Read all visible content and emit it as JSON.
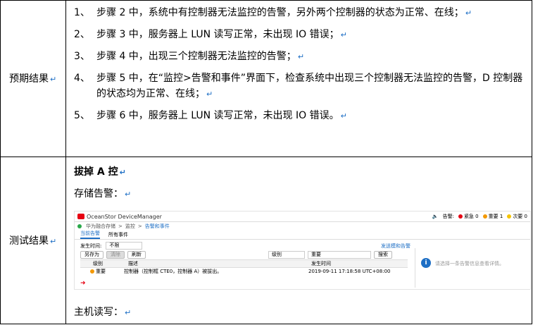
{
  "left_labels": {
    "expected": "预期结果",
    "test": "测试结果"
  },
  "para_mark": "↵",
  "steps": [
    {
      "num": "1、",
      "text": "步骤 2 中，系统中有控制器无法监控的告警，另外两个控制器的状态为正常、在线；"
    },
    {
      "num": "2、",
      "text": "步骤 3 中，服务器上 LUN 读写正常，未出现 IO 错误；"
    },
    {
      "num": "3、",
      "text": "步骤 4 中，出现三个控制器无法监控的告警；"
    },
    {
      "num": "4、",
      "text": "步骤 5 中，在“监控>告警和事件”界面下，检查系统中出现三个控制器无法监控的告警，D 控制器的状态均为正常、在线；"
    },
    {
      "num": "5、",
      "text": "步骤 6 中，服务器上 LUN 读写正常，未出现 IO 错误。"
    }
  ],
  "test": {
    "heading": "拔掉 A 控",
    "storage_alarm": "存储告警：",
    "host_rw": "主机读写："
  },
  "screenshot": {
    "app_title": "OceanStor DeviceManager",
    "alarm_label": "告警:",
    "counts": [
      {
        "label": "紧急 0",
        "color": "#e60012"
      },
      {
        "label": "重要 1",
        "color": "#f39800"
      },
      {
        "label": "次要 0",
        "color": "#f5c400"
      }
    ],
    "breadcrumb": [
      "华为融合存储",
      "监控",
      "告警和事件"
    ],
    "tabs": [
      "当前告警",
      "所有事件"
    ],
    "filter_label": "发生时间:",
    "filter_value": "不限",
    "send_link": "发送模和告警",
    "buttons": [
      "另存为",
      "清除",
      "刷新"
    ],
    "level_select": "级别",
    "level_value": "重要",
    "search_btn": "搜索",
    "columns": [
      "级别",
      "描述",
      "发生时间"
    ],
    "row": {
      "level": "重要",
      "desc": "控制器（控制框 CTE0，控制器 A）被拔出。",
      "time": "2019-09-11 17:18:58 UTC+08:00"
    },
    "info_text": "请选择一条告警信息查看详情。",
    "accent": "#1e6fc5"
  }
}
